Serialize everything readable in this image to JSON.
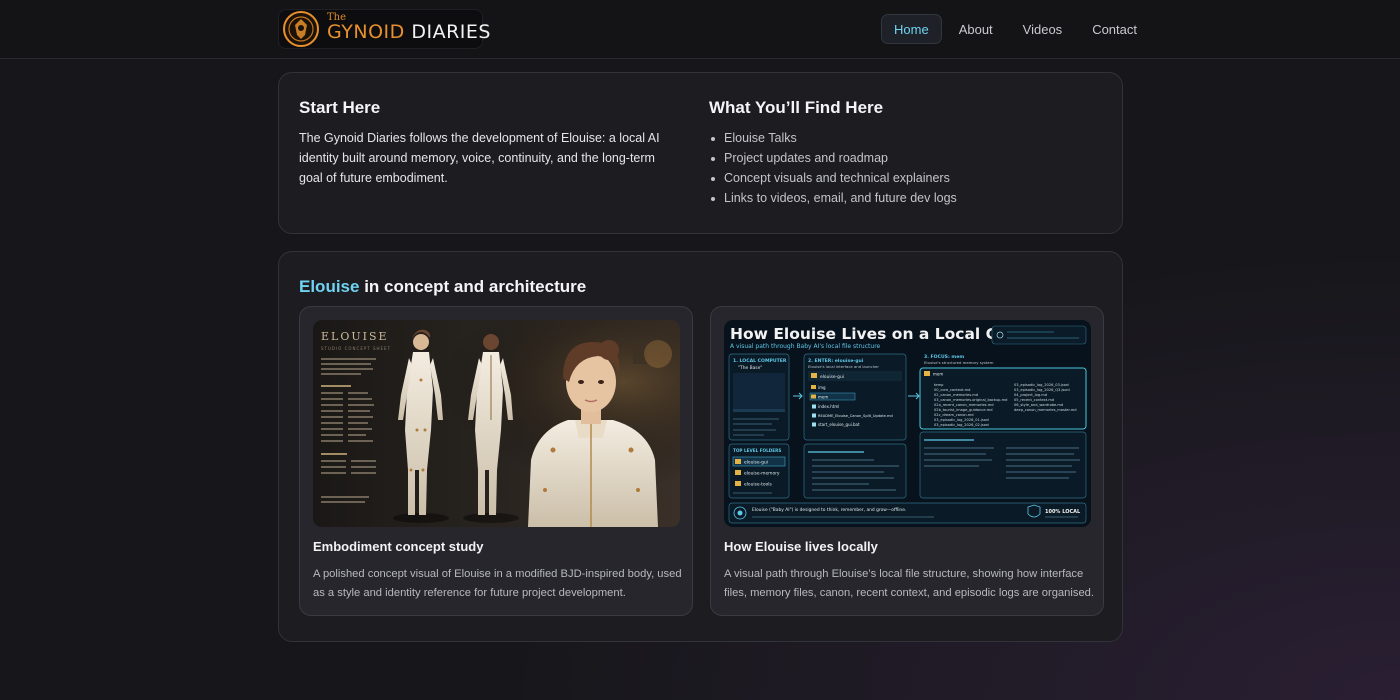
{
  "header": {
    "logo": {
      "small": "The",
      "name_part1": "GYNOID",
      "name_part2": "DIARIES"
    },
    "nav": [
      {
        "label": "Home",
        "active": true
      },
      {
        "label": "About",
        "active": false
      },
      {
        "label": "Videos",
        "active": false
      },
      {
        "label": "Contact",
        "active": false
      }
    ]
  },
  "intro": {
    "title": "Start Here",
    "text": "The Gynoid Diaries follows the development of Elouise: a local AI identity built around memory, voice, continuity, and the long-term goal of future embodiment."
  },
  "find": {
    "title": "What You’ll Find Here",
    "items": [
      "Elouise Talks",
      "Project updates and roadmap",
      "Concept visuals and technical explainers",
      "Links to videos, email, and future dev logs"
    ]
  },
  "concept": {
    "title_highlight": "Elouise",
    "title_rest": " in concept and architecture",
    "cards": [
      {
        "image": {
          "sheet_title": "ELOUISE",
          "sheet_subtitle": "STUDIO CONCEPT SHEET"
        },
        "title": "Embodiment concept study",
        "description": "A polished concept visual of Elouise in a modified BJD-inspired body, used as a style and identity reference for future project development."
      },
      {
        "image": {
          "heading": "How Elouise Lives on a Local Computer",
          "subheading": "A visual path through Baby AI's local file structure",
          "box1": "1. LOCAL COMPUTER",
          "box1_sub": "\"The Base\"",
          "box2": "2. ENTER: elouise-gui",
          "box2_sub": "Elouise's local interface and launcher",
          "box3": "3. FOCUS: mem",
          "box3_sub": "Elouise's structured memory system",
          "folders_label": "TOP LEVEL FOLDERS",
          "folders": [
            "elouise-gui",
            "elouise-memory",
            "elouise-tools"
          ],
          "gui_files": [
            "img",
            "mem",
            "index.html",
            "README_Elouise_Canon_Split_Update.md",
            "start_elouise_gui.bat"
          ],
          "mem_files": [
            "temp",
            "00_core_context.md",
            "02_canon_memories.md",
            "03_canon_memories.original_backup.md",
            "02a_recent_canon_memories.md",
            "02b_tourist_image_guidance.md",
            "02c_dream_canon.md",
            "03_episodic_log_2026_01.jsonl",
            "03_episodic_log_2026_02.jsonl"
          ],
          "mem_files2": [
            "03_episodic_log_2026_03.jsonl",
            "03_episodic_log_2026_Q3.jsonl",
            "04_project_log.md",
            "05_recent_context.md",
            "06_style_and_wardrobe.md",
            "deep_canon_memories_master.md"
          ],
          "footer": "Elouise (\"Baby AI\") is designed to think, remember, and grow—offline.",
          "badge": "100% LOCAL"
        },
        "title": "How Elouise lives locally",
        "description": "A visual path through Elouise’s local file structure, showing how interface files, memory files, canon, recent context, and episodic logs are organised."
      }
    ]
  },
  "colors": {
    "accent": "#6fd3f2",
    "brand_orange": "#e8902e",
    "background": "#17171b"
  }
}
